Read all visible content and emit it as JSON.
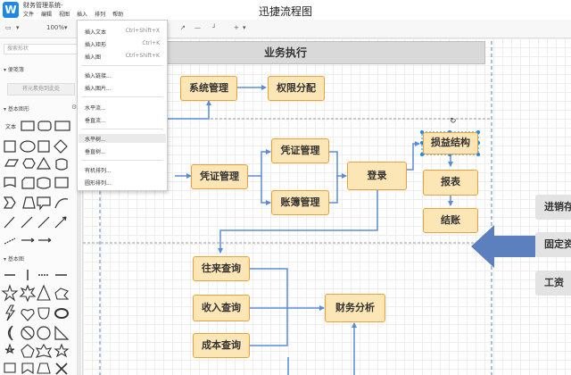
{
  "app": {
    "logo": "W",
    "name": "财务管理系统-",
    "doc_title": "迅捷流程图",
    "menu": [
      "文件",
      "编辑",
      "视图",
      "插入",
      "排列",
      "帮助"
    ]
  },
  "toolbar": {
    "zoom": "100%"
  },
  "sidebar": {
    "search_placeholder": "搜索形状",
    "section_favorites": "便笺簿",
    "favorites_button": "将元素拖到此处",
    "section_basic": "基本图形",
    "text_label": "文本",
    "section_basic2": "基本图"
  },
  "dropdown": {
    "items": [
      {
        "label": "插入文本",
        "shortcut": "Ctrl+Shift+X"
      },
      {
        "label": "插入矩形",
        "shortcut": "Ctrl+K"
      },
      {
        "label": "插入图",
        "shortcut": "Ctrl+Shift+K"
      },
      {
        "label": "插入链接...",
        "shortcut": ""
      },
      {
        "label": "插入图片...",
        "shortcut": ""
      },
      {
        "label": "水平流...",
        "shortcut": ""
      },
      {
        "label": "垂直流...",
        "shortcut": ""
      },
      {
        "label": "水平树...",
        "shortcut": ""
      },
      {
        "label": "垂直树...",
        "shortcut": ""
      },
      {
        "label": "有机排列...",
        "shortcut": ""
      },
      {
        "label": "圆形排列...",
        "shortcut": ""
      }
    ]
  },
  "diagram": {
    "pool_title": "业务执行",
    "nodes": {
      "n1": "系统管理",
      "n2": "权限分配",
      "n3": "凭证管理",
      "n4": "凭证管理",
      "n5": "账簿管理",
      "n6": "登录",
      "n7": "损益结构",
      "n8": "报表",
      "n9": "结账",
      "n10": "往来查询",
      "n11": "收入查询",
      "n12": "成本查询",
      "n13": "财务分析"
    },
    "side_tabs": [
      "进销存",
      "固定资",
      "工资"
    ]
  },
  "colors": {
    "node_fill": "#fde6b5",
    "node_border": "#e9a23b",
    "connector": "#5b8bd6",
    "big_arrow": "#5b80bd",
    "selection": "#1e88e5"
  }
}
